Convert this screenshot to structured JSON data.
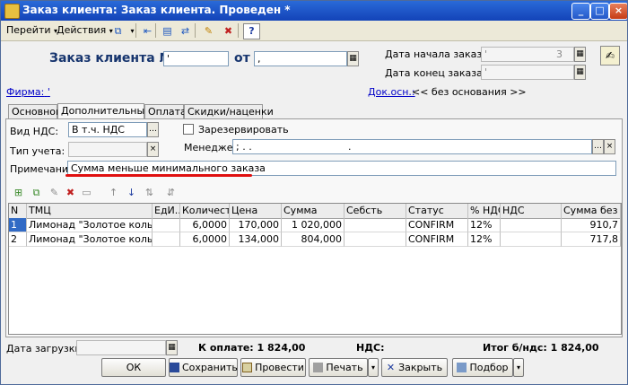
{
  "window": {
    "title": "Заказ клиента: Заказ клиента. Проведен *"
  },
  "menu": {
    "goto": "Перейти",
    "actions": "Действия",
    "help": "?"
  },
  "header": {
    "doc_title": "Заказ клиента №:",
    "number": "'",
    "from_label": "от",
    "date": ",",
    "start_date_label": "Дата начала заказа:",
    "start_date_value": "'",
    "start_date_end": "3",
    "end_date_label": "Дата конец заказа:",
    "end_date_value": "'"
  },
  "firm": {
    "label": "Фирма:",
    "value": "'"
  },
  "basis": {
    "label": "Док.осн.:",
    "value": "<< без основания >>"
  },
  "tabs": [
    "Основной",
    "Дополнительный",
    "Оплата",
    "Скидки/наценки"
  ],
  "form": {
    "vat_label": "Вид НДС:",
    "vat_value": "В т.ч. НДС",
    "reserve_label": "Зарезервировать",
    "accounting_label": "Тип учета:",
    "manager_label": "Менеджер:",
    "manager_value": ";      .  .",
    "manager_dot": ".",
    "note_label": "Примечание:",
    "note_value": "Сумма меньше минимального заказа"
  },
  "grid": {
    "columns": [
      "N",
      "ТМЦ",
      "ЕдИ...",
      "Количест...",
      "Цена",
      "Сумма",
      "Себсть",
      "Статус",
      "% НДС",
      "НДС",
      "Сумма без ..."
    ],
    "rows": [
      [
        "1",
        "Лимонад \"Золотое кольцо...",
        "",
        "6,0000",
        "170,000",
        "1 020,000",
        "",
        "CONFIRM",
        "12%",
        "",
        "910,7"
      ],
      [
        "2",
        "Лимонад \"Золотое кольцо...",
        "",
        "6,0000",
        "134,000",
        "804,000",
        "",
        "CONFIRM",
        "12%",
        "",
        "717,8"
      ]
    ]
  },
  "footer": {
    "load_date_label": "Дата загрузки:",
    "to_pay": "К оплате: 1 824,00",
    "vat_total": "НДС:",
    "total_wo_vat": "Итог б/ндс:  1 824,00"
  },
  "buttons": {
    "ok": "ОК",
    "save": "Сохранить",
    "post": "Провести",
    "print": "Печать",
    "close": "Закрыть",
    "selection": "Подбор"
  }
}
